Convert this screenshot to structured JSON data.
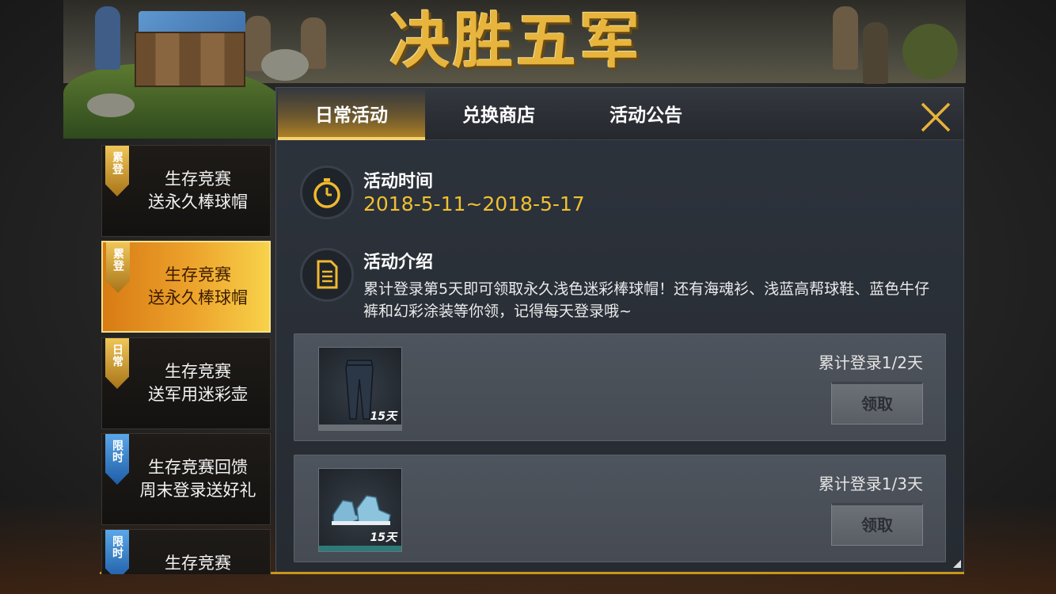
{
  "banner": {
    "title": "决胜五军"
  },
  "tabs": [
    {
      "label": "日常活动",
      "active": true
    },
    {
      "label": "兑换商店",
      "active": false
    },
    {
      "label": "活动公告",
      "active": false
    }
  ],
  "info": {
    "time_label": "活动时间",
    "time_value": "2018-5-11~2018-5-17",
    "intro_label": "活动介绍",
    "intro_text": "累计登录第5天即可领取永久浅色迷彩棒球帽！还有海魂衫、浅蓝高帮球鞋、蓝色牛仔裤和幻彩涂装等你领，记得每天登录哦~"
  },
  "rewards": [
    {
      "item_icon": "jeans-icon",
      "days": "15天",
      "progress": "累计登录1/2天",
      "button": "领取",
      "accent_color": "#6a6f76"
    },
    {
      "item_icon": "high-top-sneaker-icon",
      "days": "15天",
      "progress": "累计登录1/3天",
      "button": "领取",
      "accent_color": "#2e7a78"
    }
  ],
  "sidebar": {
    "items": [
      {
        "badge": "累登",
        "badge_color": "gold",
        "line1": "生存竞赛",
        "line2": "送永久棒球帽",
        "active": false
      },
      {
        "badge": "累登",
        "badge_color": "gold",
        "line1": "生存竞赛",
        "line2": "送永久棒球帽",
        "active": true
      },
      {
        "badge": "日常",
        "badge_color": "gold",
        "line1": "生存竞赛",
        "line2": "送军用迷彩壶",
        "active": false
      },
      {
        "badge": "限时",
        "badge_color": "blue",
        "line1": "生存竞赛回馈",
        "line2": "周末登录送好礼",
        "active": false
      },
      {
        "badge": "限时",
        "badge_color": "blue",
        "line1": "生存竞赛",
        "line2": "",
        "active": false
      }
    ]
  },
  "colors": {
    "accent_gold": "#e8a624",
    "date_text": "#f0c030",
    "badge_blue": "#3a7fc8"
  }
}
